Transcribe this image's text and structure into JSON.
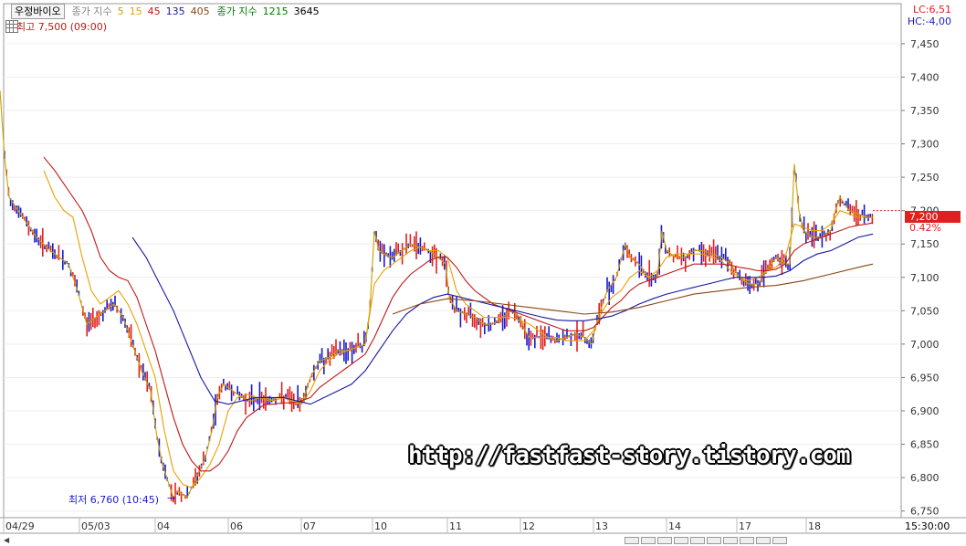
{
  "header": {
    "stock_name": "우정바이오",
    "ma_label": "종가 지수",
    "ma_periods": [
      {
        "period": "5",
        "color": "#c8a000"
      },
      {
        "period": "15",
        "color": "#e8a000"
      },
      {
        "period": "45",
        "color": "#c01818"
      },
      {
        "period": "135",
        "color": "#1818a0"
      },
      {
        "period": "405",
        "color": "#8b4513"
      }
    ],
    "ma2_label": "종가 지수",
    "ma2_periods": [
      {
        "period": "1215",
        "color": "#008000"
      },
      {
        "period": "3645",
        "color": "#000000"
      }
    ]
  },
  "high_label": "최고 7,500 (09:00)",
  "low_label": "최저 6,760 (10:45)",
  "lc_label": "LC:6,51",
  "hc_label": "HC:-4,00",
  "current_price": "7,200",
  "current_change": "0.42%",
  "time_label": "15:30:00",
  "watermark": "http://fastfast-story.tistory.com",
  "colors": {
    "up": "#e0201e",
    "down": "#1a1acd",
    "ma5": "#c8a000",
    "ma15": "#e8a000",
    "ma45": "#c01818",
    "ma135": "#1818a0",
    "ma405": "#8b4513"
  },
  "chart_data": {
    "type": "line",
    "xlabel": "",
    "ylabel": "",
    "ylim": [
      6740,
      7510
    ],
    "y_ticks": [
      "7,450",
      "7,400",
      "7,350",
      "7,300",
      "7,250",
      "7,200",
      "7,150",
      "7,100",
      "7,050",
      "7,000",
      "6,950",
      "6,900",
      "6,850",
      "6,800",
      "6,750"
    ],
    "x_ticks": [
      "04/29",
      "05/03",
      "04",
      "06",
      "07",
      "10",
      "11",
      "12",
      "13",
      "14",
      "17",
      "18"
    ],
    "series": [
      {
        "name": "5",
        "color": "#c8a000",
        "x": [
          0,
          5,
          10,
          20,
          30,
          40,
          55,
          75,
          85,
          95,
          105,
          115,
          125,
          135,
          145,
          155,
          165,
          172,
          178,
          185,
          190,
          195,
          205,
          215,
          225,
          232,
          238,
          245,
          255,
          265,
          275,
          285,
          295,
          305,
          315,
          325,
          333,
          340,
          350,
          360,
          370,
          380,
          390,
          400,
          405,
          410,
          415,
          420,
          430,
          440,
          450,
          460,
          470,
          480,
          488,
          492,
          500,
          510,
          520,
          530,
          540,
          550,
          560,
          570,
          575,
          580,
          590,
          600,
          610,
          620,
          630,
          640,
          648,
          655,
          665,
          675,
          685,
          690,
          700,
          710,
          720,
          725,
          730,
          740,
          750,
          760,
          770,
          780,
          790,
          800,
          810,
          820,
          830,
          840,
          850,
          860,
          865,
          870,
          875,
          880,
          890,
          900,
          910,
          915,
          920,
          930,
          940,
          950,
          956
        ],
        "y": [
          7380,
          7280,
          7220,
          7200,
          7180,
          7160,
          7140,
          7120,
          7080,
          7030,
          7040,
          7050,
          7060,
          7040,
          7000,
          6960,
          6930,
          6860,
          6820,
          6790,
          6770,
          6780,
          6770,
          6800,
          6830,
          6870,
          6920,
          6940,
          6930,
          6920,
          6915,
          6920,
          6915,
          6920,
          6920,
          6910,
          6920,
          6950,
          6975,
          6980,
          6990,
          6990,
          6995,
          7000,
          7050,
          7170,
          7140,
          7135,
          7130,
          7140,
          7150,
          7145,
          7140,
          7130,
          7120,
          7070,
          7050,
          7045,
          7040,
          7030,
          7030,
          7040,
          7050,
          7040,
          7020,
          7010,
          7010,
          7010,
          7005,
          7010,
          7015,
          7010,
          7000,
          7040,
          7080,
          7100,
          7150,
          7130,
          7120,
          7100,
          7100,
          7170,
          7140,
          7130,
          7130,
          7140,
          7140,
          7135,
          7130,
          7120,
          7100,
          7090,
          7090,
          7110,
          7130,
          7120,
          7120,
          7270,
          7200,
          7170,
          7160,
          7160,
          7170,
          7200,
          7220,
          7200,
          7195,
          7190,
          7190
        ]
      },
      {
        "name": "15",
        "color": "#e8a000",
        "x": [
          48,
          60,
          70,
          80,
          90,
          100,
          110,
          120,
          130,
          140,
          150,
          160,
          170,
          180,
          190,
          200,
          210,
          220,
          230,
          240,
          250,
          260,
          270,
          280,
          290,
          300,
          310,
          320,
          330,
          340,
          350,
          360,
          370,
          380,
          390,
          400,
          410,
          420,
          430,
          440,
          450,
          460,
          470,
          480,
          490,
          500,
          510,
          520,
          530,
          540,
          550,
          560,
          570,
          580,
          590,
          600,
          610,
          620,
          630,
          640,
          650,
          660,
          670,
          680,
          690,
          700,
          710,
          720,
          730,
          740,
          750,
          760,
          770,
          780,
          790,
          800,
          810,
          820,
          830,
          840,
          850,
          860,
          870,
          880,
          890,
          900,
          910,
          920,
          930,
          940,
          950,
          956
        ],
        "y": [
          7260,
          7220,
          7200,
          7190,
          7130,
          7080,
          7060,
          7070,
          7080,
          7060,
          7030,
          6990,
          6950,
          6870,
          6810,
          6790,
          6785,
          6800,
          6820,
          6850,
          6900,
          6920,
          6925,
          6920,
          6920,
          6915,
          6920,
          6915,
          6910,
          6930,
          6960,
          6975,
          6985,
          6990,
          6995,
          7000,
          7090,
          7110,
          7120,
          7130,
          7140,
          7145,
          7140,
          7140,
          7130,
          7080,
          7060,
          7050,
          7040,
          7040,
          7040,
          7040,
          7035,
          7030,
          7020,
          7010,
          7010,
          7005,
          7005,
          7005,
          7020,
          7050,
          7070,
          7080,
          7100,
          7110,
          7100,
          7110,
          7130,
          7135,
          7135,
          7135,
          7135,
          7130,
          7125,
          7110,
          7100,
          7095,
          7100,
          7110,
          7115,
          7130,
          7180,
          7175,
          7170,
          7170,
          7180,
          7200,
          7195,
          7190,
          7190,
          7190
        ]
      },
      {
        "name": "45",
        "color": "#c01818",
        "x": [
          48,
          60,
          70,
          80,
          90,
          100,
          110,
          120,
          130,
          140,
          150,
          160,
          170,
          180,
          190,
          200,
          210,
          220,
          230,
          240,
          250,
          260,
          270,
          280,
          290,
          300,
          310,
          320,
          330,
          340,
          350,
          360,
          370,
          380,
          390,
          400,
          410,
          420,
          430,
          440,
          450,
          460,
          470,
          480,
          490,
          500,
          510,
          520,
          530,
          540,
          550,
          560,
          570,
          580,
          590,
          600,
          610,
          620,
          630,
          640,
          650,
          660,
          670,
          680,
          690,
          700,
          710,
          720,
          730,
          740,
          750,
          760,
          770,
          780,
          790,
          800,
          810,
          820,
          830,
          840,
          850,
          860,
          870,
          880,
          890,
          900,
          910,
          920,
          930,
          940,
          950,
          956
        ],
        "y": [
          7280,
          7260,
          7240,
          7220,
          7200,
          7170,
          7130,
          7110,
          7100,
          7095,
          7070,
          7030,
          6990,
          6940,
          6890,
          6850,
          6825,
          6810,
          6810,
          6820,
          6840,
          6870,
          6890,
          6900,
          6910,
          6910,
          6912,
          6912,
          6915,
          6920,
          6935,
          6945,
          6955,
          6965,
          6975,
          6985,
          7010,
          7040,
          7070,
          7090,
          7105,
          7115,
          7125,
          7130,
          7130,
          7115,
          7095,
          7080,
          7070,
          7060,
          7055,
          7050,
          7045,
          7040,
          7035,
          7030,
          7025,
          7020,
          7020,
          7020,
          7025,
          7040,
          7055,
          7065,
          7080,
          7090,
          7095,
          7100,
          7105,
          7110,
          7115,
          7120,
          7120,
          7120,
          7120,
          7118,
          7115,
          7113,
          7110,
          7110,
          7112,
          7120,
          7140,
          7150,
          7155,
          7160,
          7165,
          7170,
          7175,
          7178,
          7180,
          7182
        ]
      },
      {
        "name": "135",
        "color": "#1818a0",
        "x": [
          145,
          160,
          175,
          190,
          205,
          220,
          235,
          250,
          265,
          280,
          295,
          310,
          325,
          340,
          355,
          370,
          385,
          400,
          415,
          430,
          445,
          460,
          475,
          490,
          505,
          520,
          535,
          550,
          565,
          580,
          595,
          610,
          625,
          640,
          655,
          670,
          685,
          700,
          715,
          730,
          745,
          760,
          775,
          790,
          805,
          820,
          835,
          850,
          865,
          880,
          895,
          910,
          925,
          940,
          956
        ],
        "y": [
          7160,
          7130,
          7090,
          7050,
          7000,
          6950,
          6915,
          6910,
          6915,
          6920,
          6920,
          6920,
          6915,
          6910,
          6920,
          6930,
          6940,
          6960,
          6990,
          7020,
          7045,
          7060,
          7070,
          7075,
          7070,
          7065,
          7060,
          7055,
          7050,
          7045,
          7040,
          7036,
          7035,
          7035,
          7038,
          7042,
          7050,
          7060,
          7068,
          7075,
          7080,
          7085,
          7090,
          7095,
          7100,
          7100,
          7100,
          7102,
          7110,
          7125,
          7135,
          7140,
          7150,
          7160,
          7165
        ]
      },
      {
        "name": "405",
        "color": "#8b4513",
        "x": [
          430,
          460,
          490,
          520,
          550,
          580,
          610,
          640,
          670,
          700,
          730,
          760,
          790,
          820,
          850,
          880,
          910,
          940,
          956
        ],
        "y": [
          7045,
          7060,
          7068,
          7065,
          7060,
          7055,
          7050,
          7045,
          7048,
          7055,
          7065,
          7075,
          7080,
          7085,
          7088,
          7095,
          7105,
          7115,
          7120
        ]
      }
    ],
    "markers": [
      {
        "label": "최고 7,500 (09:00)",
        "y": 7500
      },
      {
        "label": "최저 6,760 (10:45)",
        "y": 6760
      }
    ]
  }
}
